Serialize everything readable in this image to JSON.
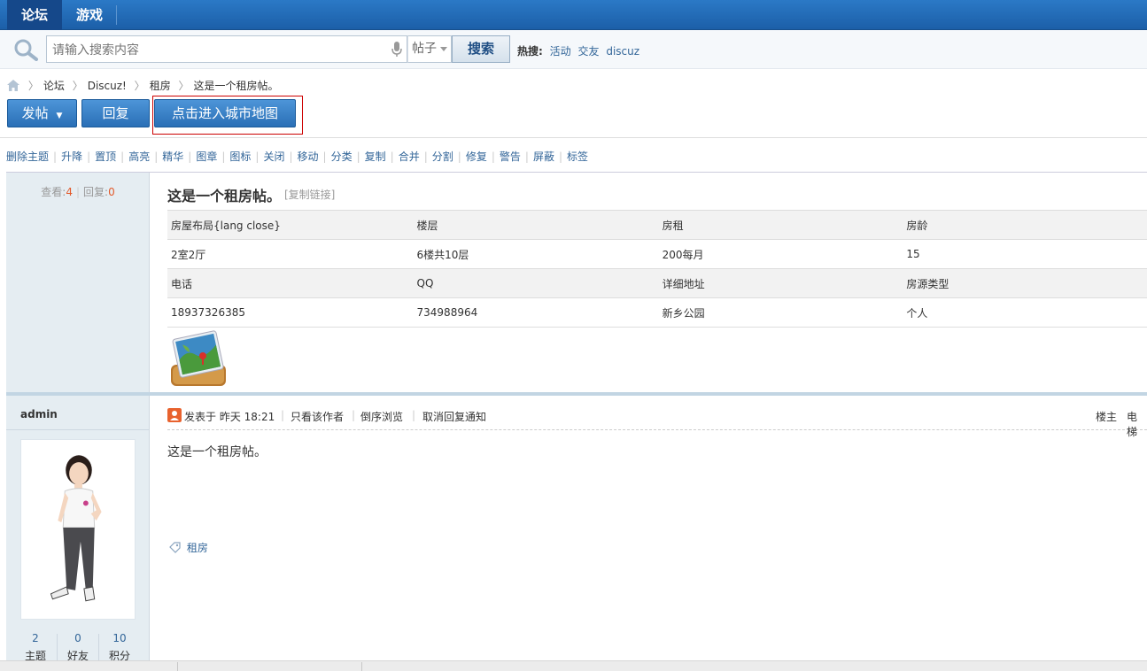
{
  "topnav": {
    "tabs": [
      "论坛",
      "游戏"
    ]
  },
  "search": {
    "placeholder": "请输入搜索内容",
    "type_selected": "帖子",
    "button": "搜索",
    "hot_label": "热搜:",
    "hot_links": [
      "活动",
      "交友",
      "discuz"
    ]
  },
  "breadcrumb": [
    "论坛",
    "Discuz!",
    "租房",
    "这是一个租房帖。"
  ],
  "actions": {
    "post": "发帖",
    "reply": "回复",
    "city_map": "点击进入城市地图"
  },
  "mod_tools": [
    "删除主题",
    "升降",
    "置顶",
    "高亮",
    "精华",
    "图章",
    "图标",
    "关闭",
    "移动",
    "分类",
    "复制",
    "合并",
    "分割",
    "修复",
    "警告",
    "屏蔽",
    "标签"
  ],
  "thread": {
    "views_label": "查看:",
    "views": "4",
    "replies_label": "回复:",
    "replies": "0",
    "title": "这是一个租房帖。",
    "copy_link": "[复制链接]"
  },
  "info_table": {
    "rows": [
      [
        "房屋布局{lang close}",
        "楼层",
        "房租",
        "房龄"
      ],
      [
        "2室2厅",
        "6楼共10层",
        "200每月",
        "15"
      ],
      [
        "电话",
        "QQ",
        "详细地址",
        "房源类型"
      ],
      [
        "18937326385",
        "734988964",
        "新乡公园",
        "个人"
      ]
    ]
  },
  "post": {
    "author": "admin",
    "posted_at": "发表于 昨天 18:21",
    "only_author": "只看该作者",
    "reverse": "倒序浏览",
    "cancel_notify": "取消回复通知",
    "floor": "楼主",
    "floor_extra": "电梯",
    "body": "这是一个租房帖。",
    "tag": "租房"
  },
  "author_stats": [
    {
      "value": "2",
      "label": "主题"
    },
    {
      "value": "0",
      "label": "好友"
    },
    {
      "value": "10",
      "label": "积分"
    }
  ],
  "colors": {
    "nav": "#1c5fa8",
    "link": "#336699",
    "accent_count": "#e25a2b"
  }
}
